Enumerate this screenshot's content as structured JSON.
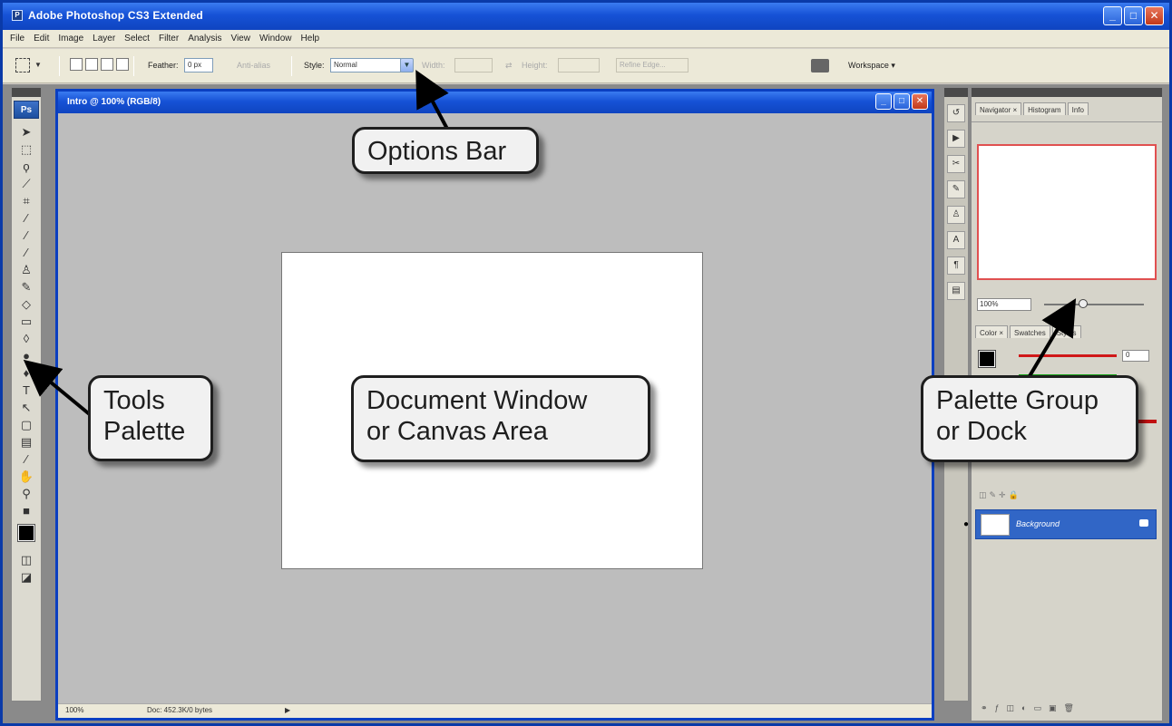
{
  "app": {
    "title": "Adobe Photoshop CS3 Extended",
    "window_controls": [
      "_",
      "□",
      "✕"
    ]
  },
  "menu": [
    "File",
    "Edit",
    "Image",
    "Layer",
    "Select",
    "Filter",
    "Analysis",
    "View",
    "Window",
    "Help"
  ],
  "options_bar": {
    "feather_label": "Feather:",
    "feather_value": "0 px",
    "antialias_label": "Anti-alias",
    "style_label": "Style:",
    "style_value": "Normal",
    "width_label": "Width:",
    "height_label": "Height:",
    "refine_edge_label": "Refine Edge...",
    "workspace_label": "Workspace ▾"
  },
  "document": {
    "title": "Intro @ 100% (RGB/8)",
    "status_zoom": "100%",
    "status_doc": "Doc: 452.3K/0 bytes"
  },
  "palettes": {
    "navigator_tabs": [
      "Navigator ×",
      "Histogram",
      "Info"
    ],
    "navigator_zoom": "100%",
    "color_tabs": [
      "Color ×",
      "Swatches",
      "Styles"
    ],
    "color_value": "0",
    "layer_name": "Background"
  },
  "callouts": {
    "options_bar": "Options Bar",
    "tools_palette_line1": "Tools",
    "tools_palette_line2": "Palette",
    "document_line1": "Document Window",
    "document_line2": "or Canvas Area",
    "dock_line1": "Palette Group",
    "dock_line2": "or Dock"
  },
  "colors": {
    "titlebar_blue": "#1652d6",
    "selected_layer": "#3166c6",
    "callout_fill": "#f1f1f1"
  }
}
